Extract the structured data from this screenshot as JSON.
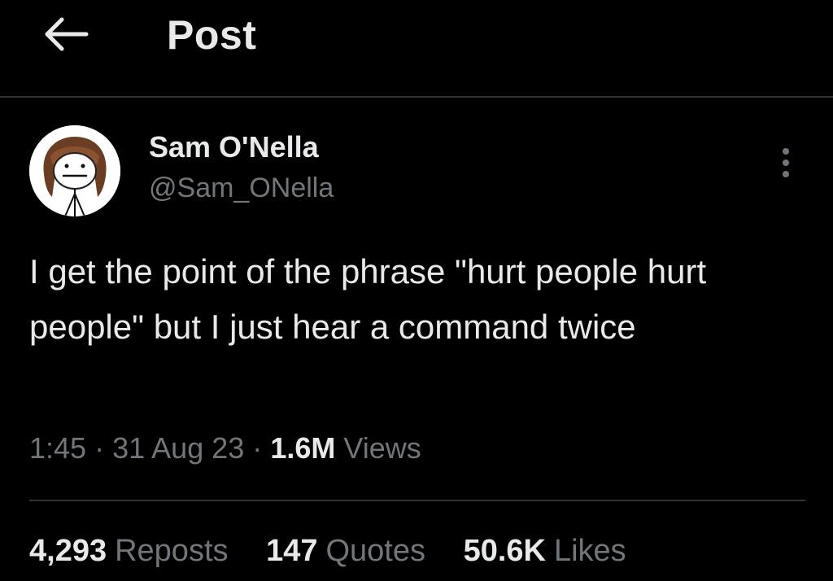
{
  "header": {
    "back_icon": "arrow-left-icon",
    "title": "Post"
  },
  "author": {
    "display_name": "Sam O'Nella",
    "handle": "@Sam_ONella",
    "avatar_icon": "cartoon-avatar"
  },
  "post": {
    "text": "I get the point of the phrase \"hurt people hurt people\" but I just hear a command twice",
    "more_icon": "more-vertical-icon"
  },
  "meta": {
    "time": "1:45",
    "separator1": "·",
    "date": "31 Aug 23",
    "separator2": "·",
    "views_count": "1.6M",
    "views_label": "Views"
  },
  "stats": {
    "reposts_count": "4,293",
    "reposts_label": "Reposts",
    "quotes_count": "147",
    "quotes_label": "Quotes",
    "likes_count": "50.6K",
    "likes_label": "Likes"
  },
  "colors": {
    "background": "#000000",
    "primary_text": "#e7e9ea",
    "secondary_text": "#71767b",
    "divider": "#2f3336"
  }
}
